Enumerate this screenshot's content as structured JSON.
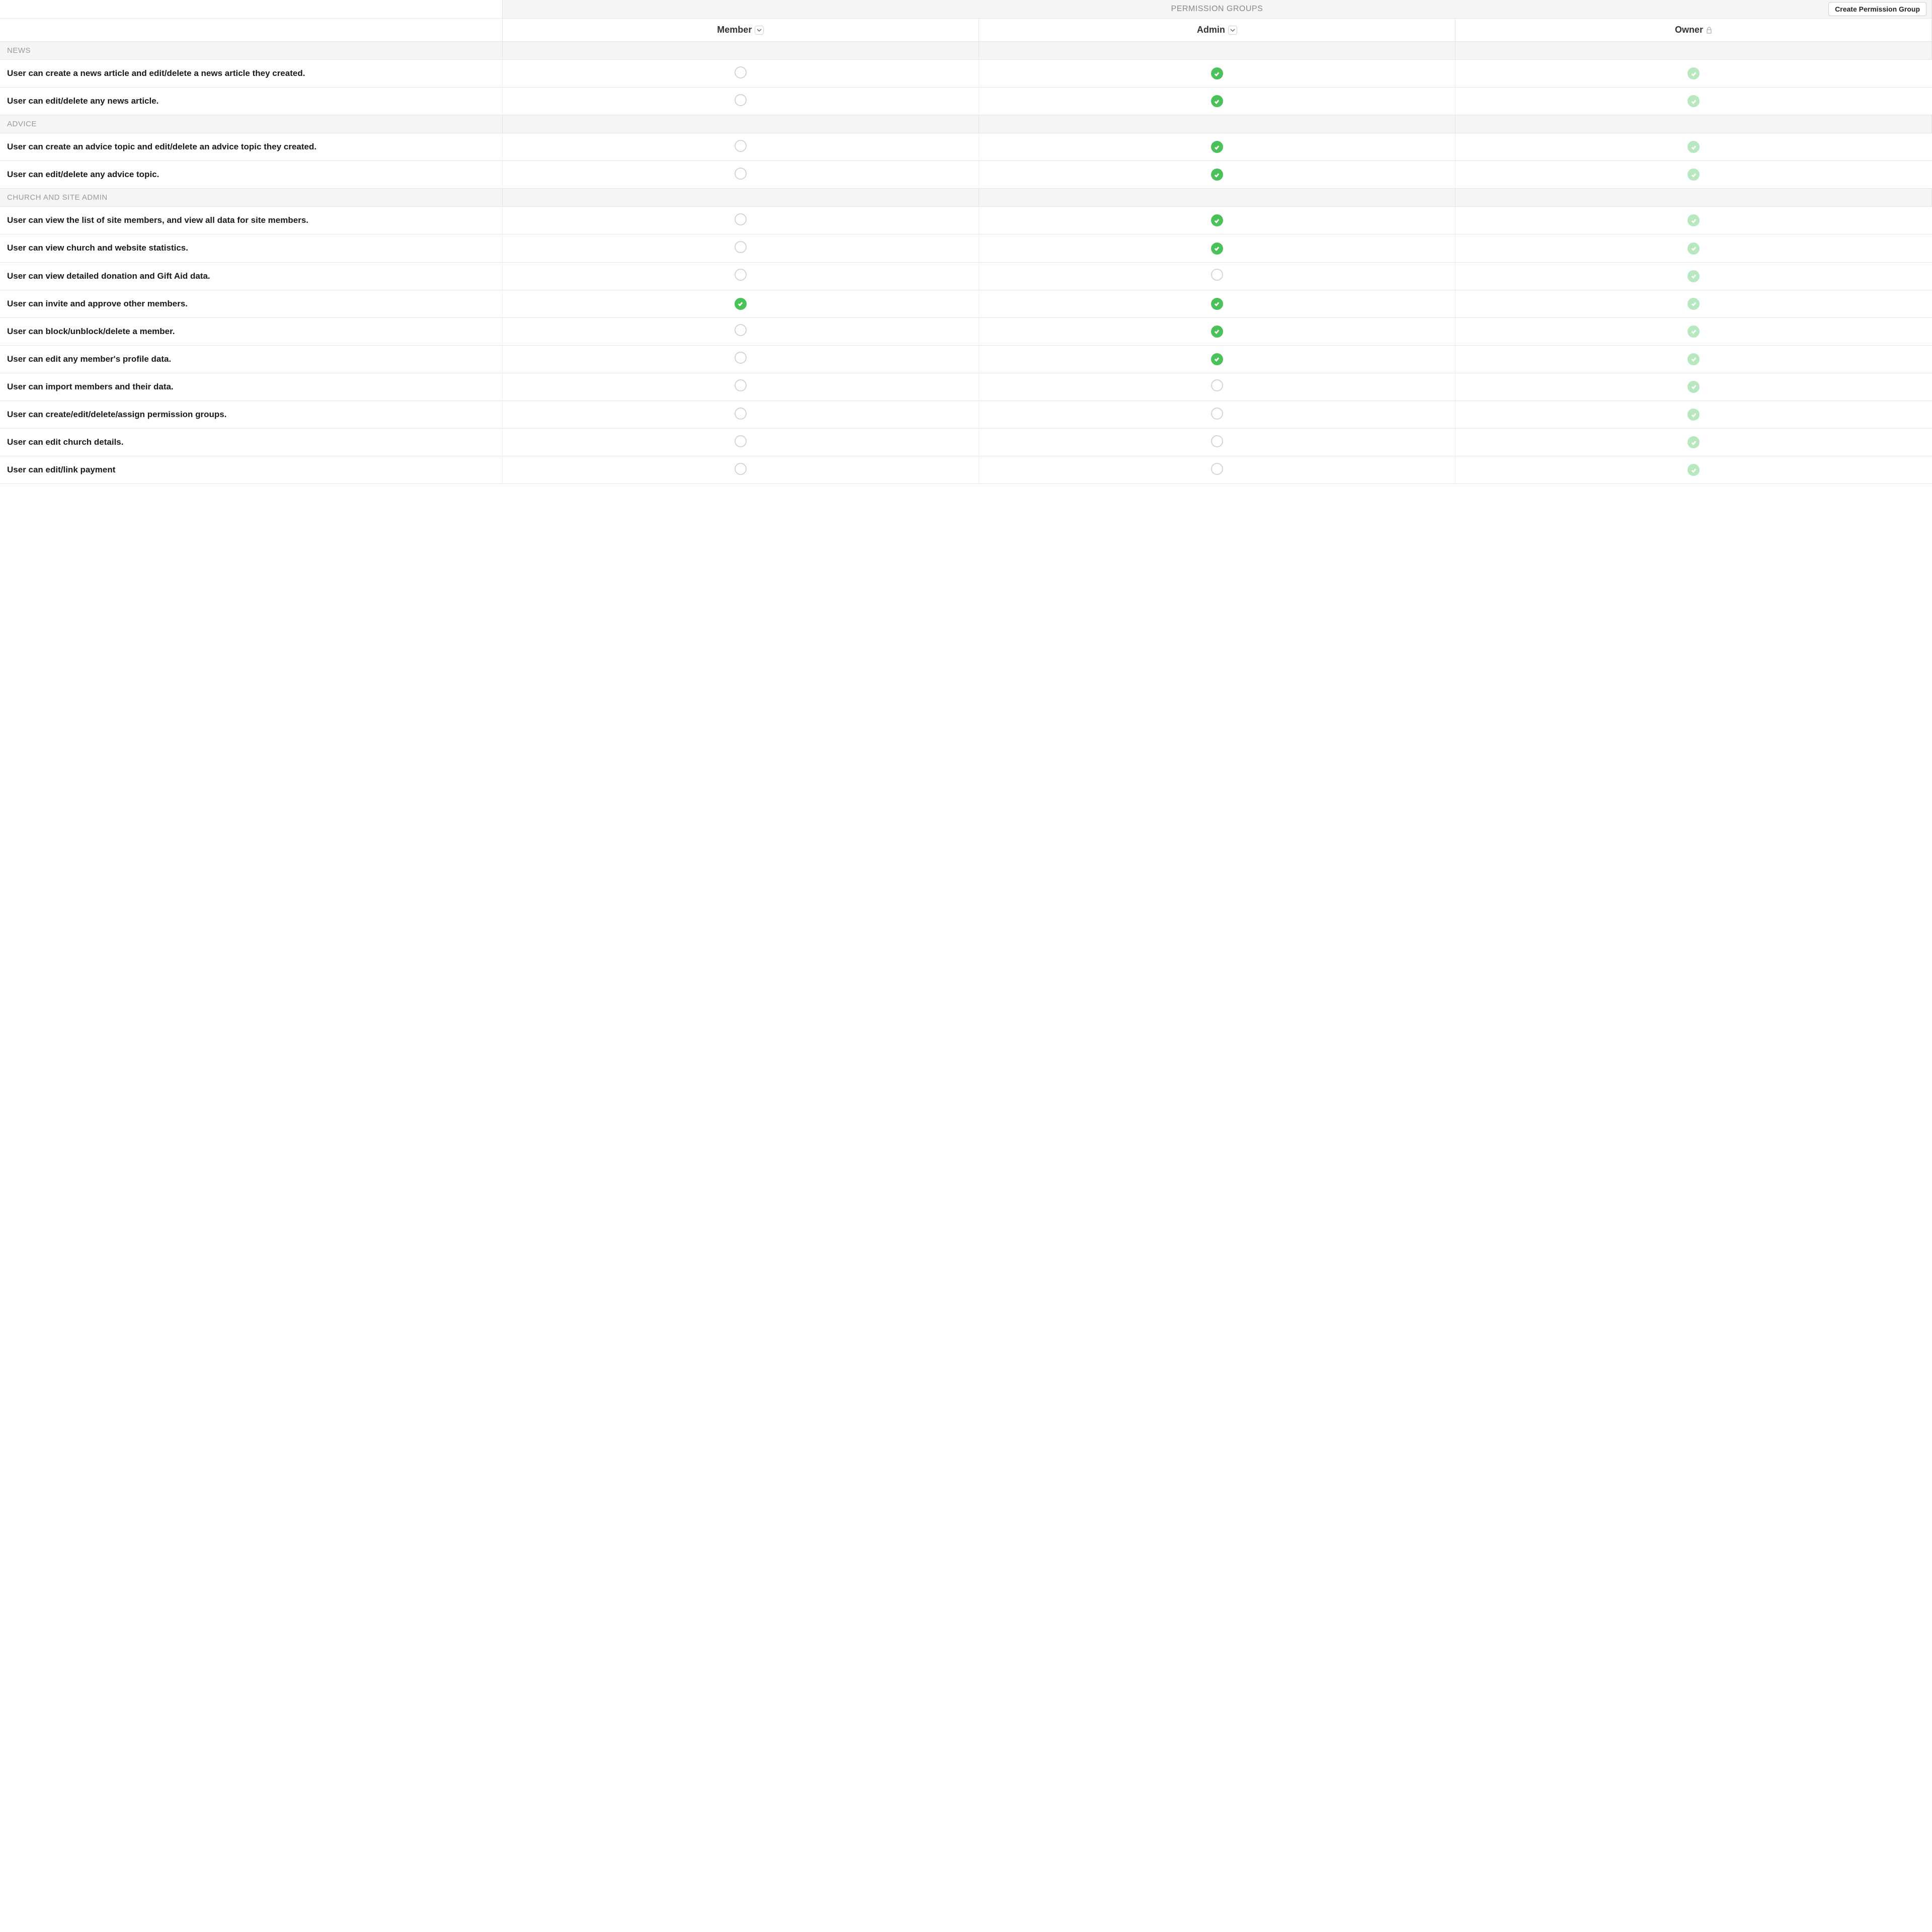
{
  "header": {
    "title": "PERMISSION GROUPS",
    "create_button": "Create Permission Group"
  },
  "groups": [
    {
      "name": "Member",
      "editable": true,
      "locked": false
    },
    {
      "name": "Admin",
      "editable": true,
      "locked": false
    },
    {
      "name": "Owner",
      "editable": false,
      "locked": true
    }
  ],
  "sections": [
    {
      "title": "NEWS",
      "permissions": [
        {
          "label": "User can create a news article and edit/delete a news article they created.",
          "values": [
            false,
            true,
            true
          ]
        },
        {
          "label": "User can edit/delete any news article.",
          "values": [
            false,
            true,
            true
          ]
        }
      ]
    },
    {
      "title": "ADVICE",
      "permissions": [
        {
          "label": "User can create an advice topic and edit/delete an advice topic they created.",
          "values": [
            false,
            true,
            true
          ]
        },
        {
          "label": "User can edit/delete any advice topic.",
          "values": [
            false,
            true,
            true
          ]
        }
      ]
    },
    {
      "title": "CHURCH AND SITE ADMIN",
      "permissions": [
        {
          "label": "User can view the list of site members, and view all data for site members.",
          "values": [
            false,
            true,
            true
          ]
        },
        {
          "label": "User can view church and website statistics.",
          "values": [
            false,
            true,
            true
          ]
        },
        {
          "label": "User can view detailed donation and Gift Aid data.",
          "values": [
            false,
            false,
            true
          ]
        },
        {
          "label": "User can invite and approve other members.",
          "values": [
            true,
            true,
            true
          ]
        },
        {
          "label": "User can block/unblock/delete a member.",
          "values": [
            false,
            true,
            true
          ]
        },
        {
          "label": "User can edit any member's profile data.",
          "values": [
            false,
            true,
            true
          ]
        },
        {
          "label": "User can import members and their data.",
          "values": [
            false,
            false,
            true
          ]
        },
        {
          "label": "User can create/edit/delete/assign permission groups.",
          "values": [
            false,
            false,
            true
          ]
        },
        {
          "label": "User can edit church details.",
          "values": [
            false,
            false,
            true
          ]
        },
        {
          "label": "User can edit/link payment",
          "values": [
            false,
            false,
            true
          ]
        }
      ]
    }
  ]
}
